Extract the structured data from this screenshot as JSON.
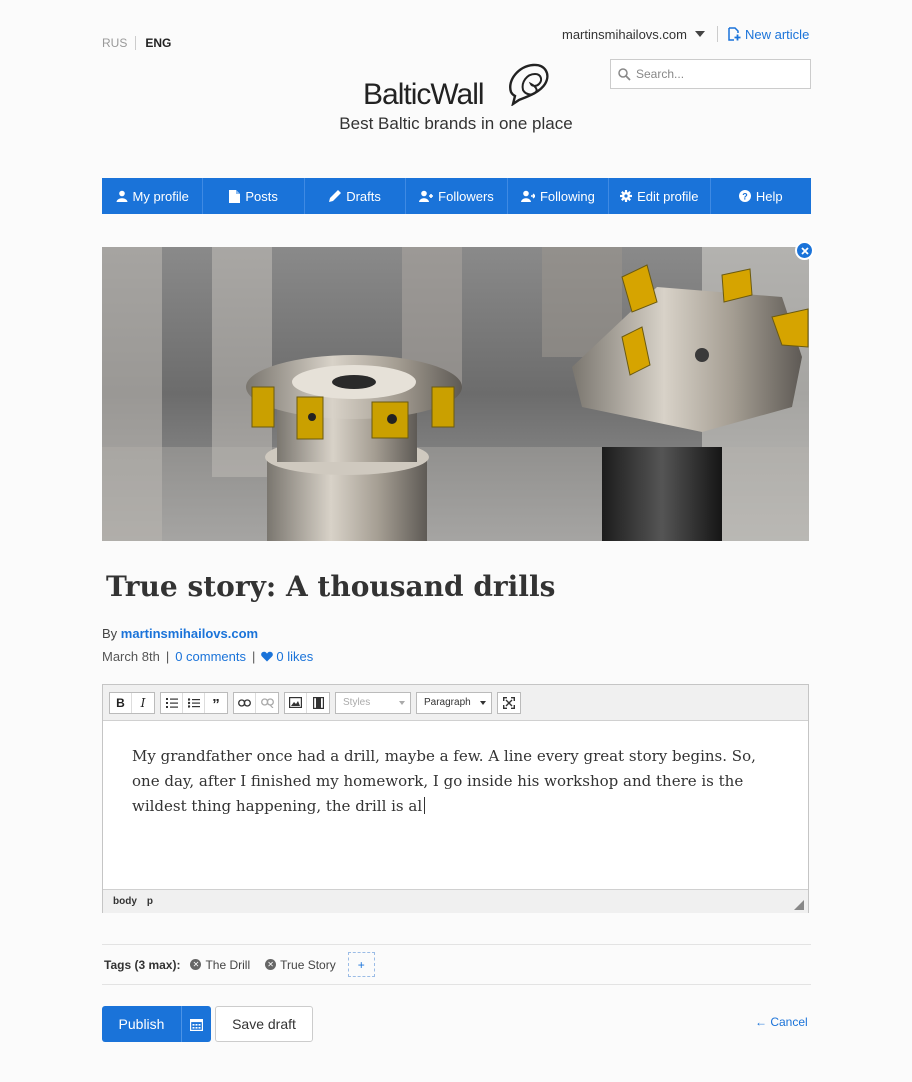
{
  "language": {
    "options": [
      "RUS",
      "ENG"
    ],
    "active": "ENG"
  },
  "account": {
    "name": "martinsmihailovs.com"
  },
  "new_article_label": "New article",
  "search": {
    "placeholder": "Search..."
  },
  "logo": {
    "name": "BalticWall",
    "tagline": "Best Baltic brands in one place"
  },
  "nav": [
    {
      "label": "My profile",
      "icon": "user-icon"
    },
    {
      "label": "Posts",
      "icon": "document-icon"
    },
    {
      "label": "Drafts",
      "icon": "pencil-icon"
    },
    {
      "label": "Followers",
      "icon": "followers-icon"
    },
    {
      "label": "Following",
      "icon": "following-icon"
    },
    {
      "label": "Edit profile",
      "icon": "gear-icon"
    },
    {
      "label": "Help",
      "icon": "help-icon"
    }
  ],
  "article": {
    "title": "True story: A thousand drills",
    "by_prefix": "By",
    "author": "martinsmihailovs.com",
    "date": "March 8th",
    "comments": "0 comments",
    "likes": "0 likes"
  },
  "editor": {
    "styles_label": "Styles",
    "format_label": "Paragraph",
    "body_text": "My grandfather once had a drill, maybe a few. A line every great story begins. So, one day, after I finished my homework, I go inside his workshop and there is the wildest thing happening, the drill is al",
    "path": [
      "body",
      "p"
    ]
  },
  "tags": {
    "label": "Tags (3 max):",
    "items": [
      "The Drill",
      "True Story"
    ],
    "add_label": "+"
  },
  "actions": {
    "publish_label": "Publish",
    "save_draft_label": "Save draft",
    "cancel_label": "← Cancel"
  },
  "colors": {
    "accent": "#1a73d9",
    "nav_bg": "#1a73d9",
    "page_bg": "#fbfbfb"
  }
}
